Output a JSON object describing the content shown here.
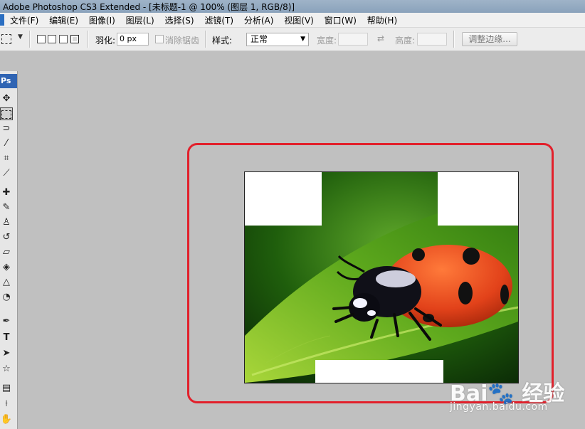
{
  "window": {
    "title": "Adobe Photoshop CS3 Extended - [未标题-1 @ 100% (图层 1, RGB/8)]"
  },
  "menu": [
    "文件(F)",
    "编辑(E)",
    "图像(I)",
    "图层(L)",
    "选择(S)",
    "滤镜(T)",
    "分析(A)",
    "视图(V)",
    "窗口(W)",
    "帮助(H)"
  ],
  "options": {
    "feather_label": "羽化:",
    "feather_value": "0 px",
    "antialias_label": "消除锯齿",
    "style_label": "样式:",
    "style_value": "正常",
    "width_label": "宽度:",
    "height_label": "高度:",
    "refine_edge_label": "调整边缘..."
  },
  "toolbox": {
    "badge": "Ps",
    "tools": [
      "move-icon",
      "marquee-icon",
      "lasso-icon",
      "magic-wand-icon",
      "crop-icon",
      "slice-icon",
      "healing-icon",
      "brush-icon",
      "stamp-icon",
      "history-brush-icon",
      "eraser-icon",
      "paint-bucket-icon",
      "blur-icon",
      "dodge-icon",
      "pen-icon",
      "type-icon",
      "path-select-icon",
      "shape-icon",
      "notes-icon",
      "eyedropper-icon",
      "hand-icon"
    ]
  },
  "watermark": {
    "logo": "Bai🐾 经验",
    "url": "jingyan.baidu.com"
  },
  "colors": {
    "highlight": "#e2202b",
    "workspace": "#c0c0c0",
    "leaf": "#4f9a18",
    "ladybug_red": "#e2421a"
  }
}
